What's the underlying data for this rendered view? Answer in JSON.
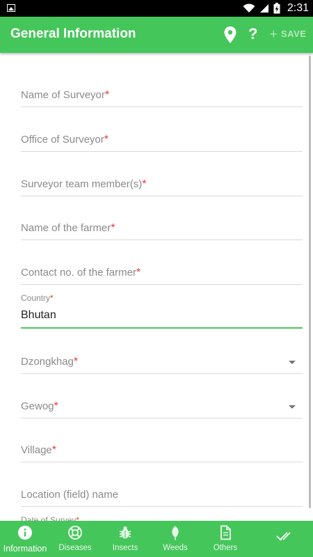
{
  "status_bar": {
    "time": "2:31"
  },
  "app_bar": {
    "title": "General Information",
    "help_label": "?",
    "save_label": "SAVE"
  },
  "form": {
    "fields": [
      {
        "label": "Name of Surveyor",
        "required": "*"
      },
      {
        "label": "Office of Surveyor",
        "required": "*"
      },
      {
        "label": "Surveyor team member(s)",
        "required": "*"
      },
      {
        "label": "Name of the farmer",
        "required": "*"
      },
      {
        "label": "Contact no. of the farmer",
        "required": "*"
      }
    ],
    "country": {
      "label": "Country",
      "required": "*",
      "value": "Bhutan"
    },
    "dzongkhag": {
      "label": "Dzongkhag",
      "required": "*"
    },
    "gewog": {
      "label": "Gewog",
      "required": "*"
    },
    "village": {
      "label": "Village",
      "required": "*"
    },
    "location": {
      "label": "Location (field) name"
    },
    "date": {
      "label": "Date of Survey",
      "required": "*"
    }
  },
  "bottom_nav": {
    "tabs": [
      {
        "label": "Information",
        "icon": "info-icon"
      },
      {
        "label": "Diseases",
        "icon": "lifebuoy-icon"
      },
      {
        "label": "Insects",
        "icon": "bug-icon"
      },
      {
        "label": "Weeds",
        "icon": "leaf-icon"
      },
      {
        "label": "Others",
        "icon": "document-icon"
      },
      {
        "label": "",
        "icon": "double-check-icon"
      }
    ]
  },
  "colors": {
    "primary": "#45c65a",
    "required": "#e53935"
  }
}
